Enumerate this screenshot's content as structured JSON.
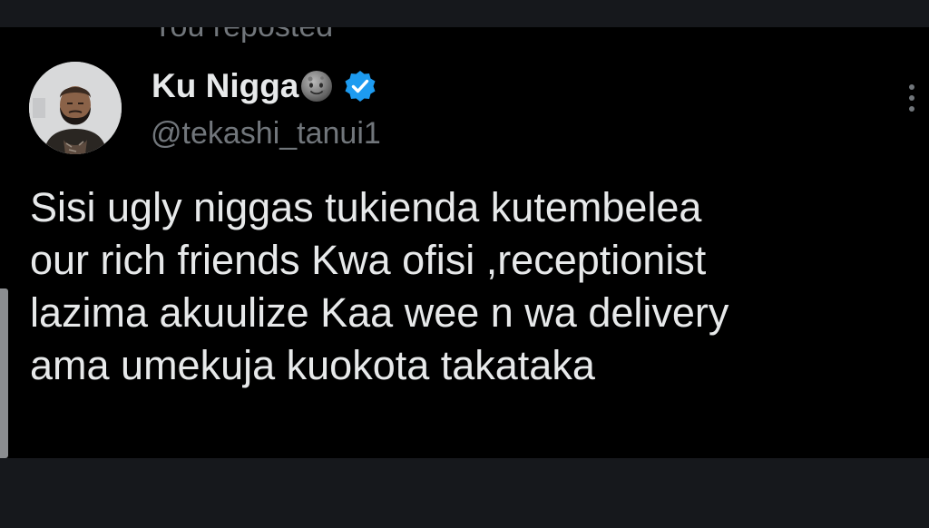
{
  "repost": {
    "label": "You reposted"
  },
  "author": {
    "display_name": "Ku Nigga",
    "name_emoji": "new-moon-face-icon",
    "verified": true,
    "verified_color": "#1d9bf0",
    "handle": "@tekashi_tanui1"
  },
  "tweet": {
    "text": "Sisi ugly niggas tukienda kutembelea\nour rich friends Kwa ofisi ,receptionist\nlazima akuulize Kaa wee n wa delivery\nama umekuja kuokota takataka"
  },
  "colors": {
    "background": "#000000",
    "frame": "#16181c",
    "primary_text": "#e7e9ea",
    "secondary_text": "#71767b",
    "accent": "#1d9bf0"
  }
}
